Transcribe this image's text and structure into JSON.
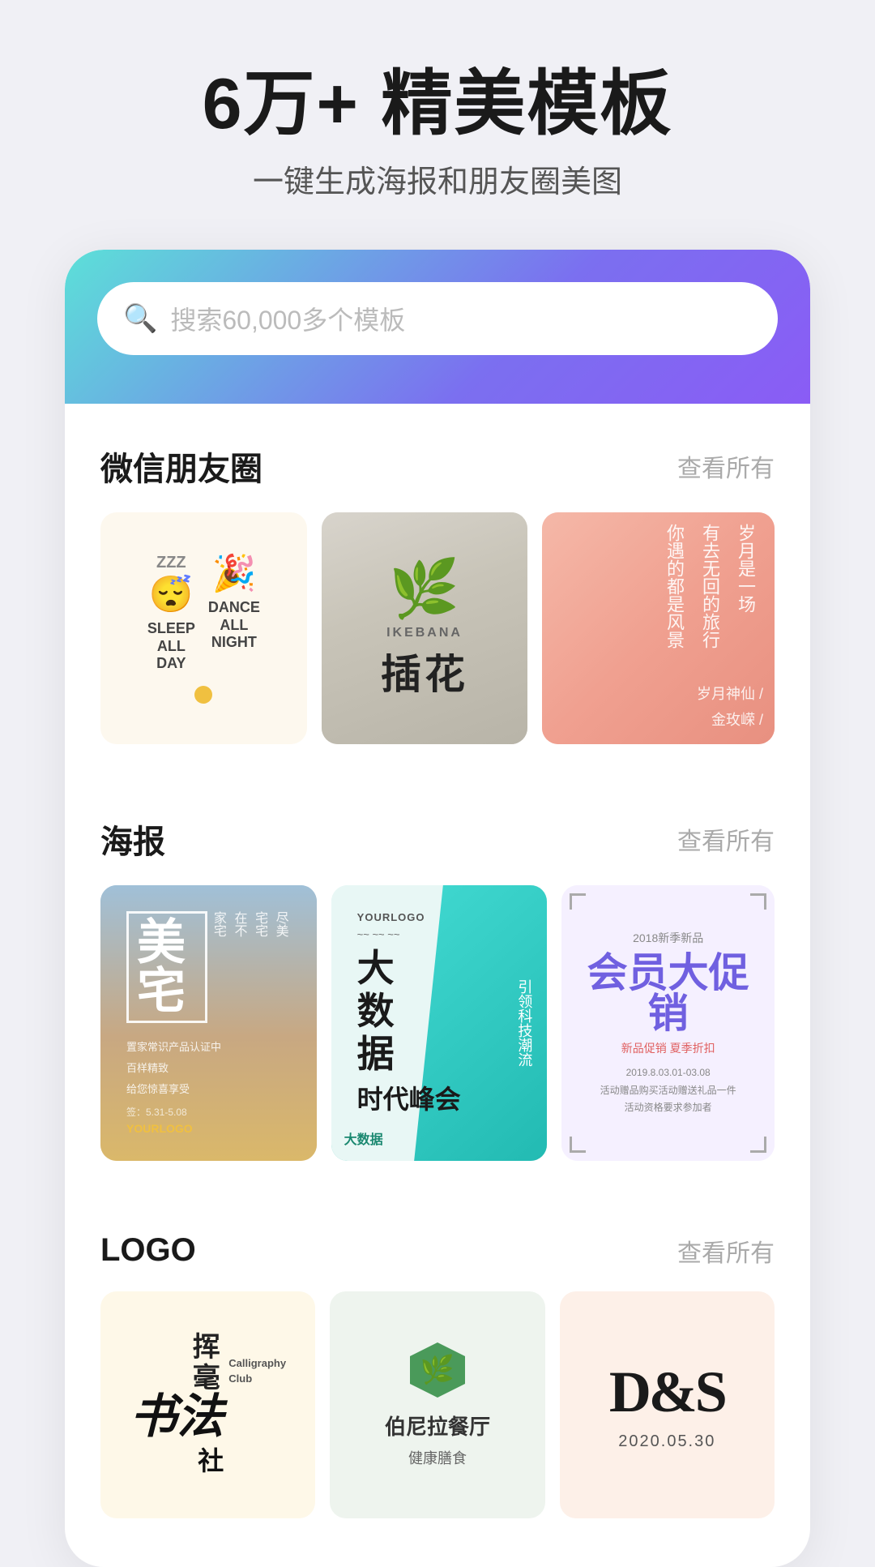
{
  "header": {
    "headline": "6万+ 精美模板",
    "subheadline": "一键生成海报和朋友圈美图"
  },
  "search": {
    "placeholder": "搜索60,000多个模板"
  },
  "sections": {
    "wechat": {
      "title": "微信朋友圈",
      "view_all": "查看所有",
      "cards": [
        {
          "type": "sleep-dance",
          "sleep_text": "SLEEP ALL DAY",
          "dance_text": "DANCE ALL NIGHT"
        },
        {
          "type": "ikebana",
          "en_label": "IKEBANA",
          "zh_label": "插花"
        },
        {
          "type": "poetry",
          "lines": [
            "岁月是一场",
            "有去无回的旅行",
            "你遇的都是风景"
          ],
          "author": "岁月神仙 /",
          "author2": "金玫嵘 /"
        }
      ]
    },
    "poster": {
      "title": "海报",
      "view_all": "查看所有",
      "cards": [
        {
          "type": "meizhai",
          "main": "美宅",
          "side_text": "尽美宅在家不宅",
          "bottom_text": "置家常识产品认证中",
          "bottom_sub": "百样精致\n给您惊喜享受",
          "date": "签：5.31-5.08",
          "logo": "YOURLOGO"
        },
        {
          "type": "bigdata",
          "logo": "YOURLOGO",
          "right_text": "引领科技潮流",
          "main": "大数据时代峰会",
          "bottom": "大数据"
        },
        {
          "type": "promotion",
          "year": "2018新季新品",
          "main": "会员大促销",
          "sub": "新品促销 夏季折扣",
          "date1": "2019.8.03.01-03.08",
          "desc": "活动赠品购买活动赠送礼品一件\n活动资格要求参加者"
        }
      ]
    },
    "logo": {
      "title": "LOGO",
      "view_all": "查看所有",
      "cards": [
        {
          "type": "calligraphy",
          "zh_big": "书法",
          "zh_stroke": "挥毫",
          "en": "Calligraphy Club",
          "zh_sub": "社"
        },
        {
          "type": "restaurant",
          "name_zh": "伯尼拉餐厅",
          "name_sub": "健康膳食"
        },
        {
          "type": "ds",
          "main": "D&S",
          "date": "2020.05.30"
        }
      ]
    }
  }
}
